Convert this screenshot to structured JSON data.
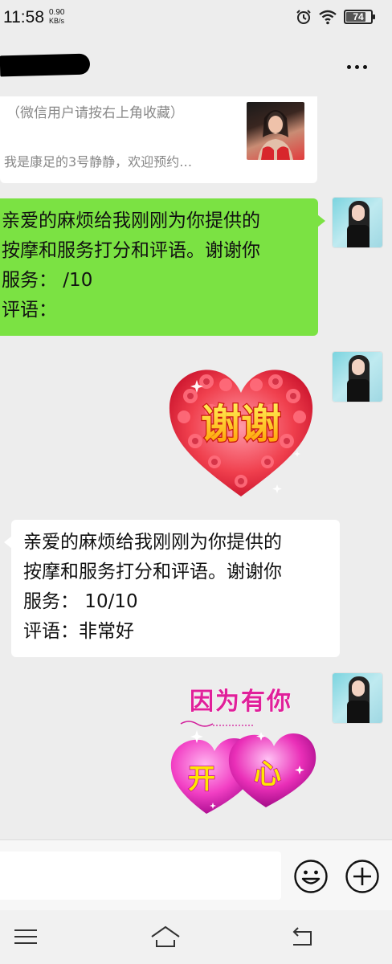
{
  "status_bar": {
    "time": "11:58",
    "speed_value": "0.90",
    "speed_unit": "KB/s",
    "battery": "74",
    "icons": [
      "alarm-clock-icon",
      "wifi-icon",
      "battery-icon"
    ]
  },
  "header": {
    "contact_name_redacted": true,
    "more_icon": "more-dots-icon"
  },
  "messages": {
    "link_card": {
      "hint": "（微信用户请按右上角收藏）",
      "description": "我是康足的3号静静，欢迎预约…"
    },
    "sent_text": {
      "lines": [
        "亲爱的麻烦给我刚刚为你提供的",
        "按摩和服务打分和评语。谢谢你",
        "服务：  /10",
        "评语："
      ]
    },
    "sticker_thanks": {
      "text": "谢谢"
    },
    "received_text": {
      "lines": [
        "亲爱的麻烦给我刚刚为你提供的",
        "按摩和服务打分和评语。谢谢你",
        "服务：  10/10",
        "评语：非常好"
      ]
    },
    "sticker_happy": {
      "top_text": "因为有你",
      "heart_text_1": "开",
      "heart_text_2": "心"
    }
  },
  "input_bar": {
    "message_value": "",
    "emoji_icon": "emoji-icon",
    "plus_icon": "plus-icon"
  },
  "nav_bar": {
    "icons": [
      "menu-icon",
      "home-icon",
      "back-icon"
    ]
  },
  "colors": {
    "sent_bubble": "#7be243",
    "received_bubble": "#ffffff",
    "chat_background": "#ededed"
  }
}
